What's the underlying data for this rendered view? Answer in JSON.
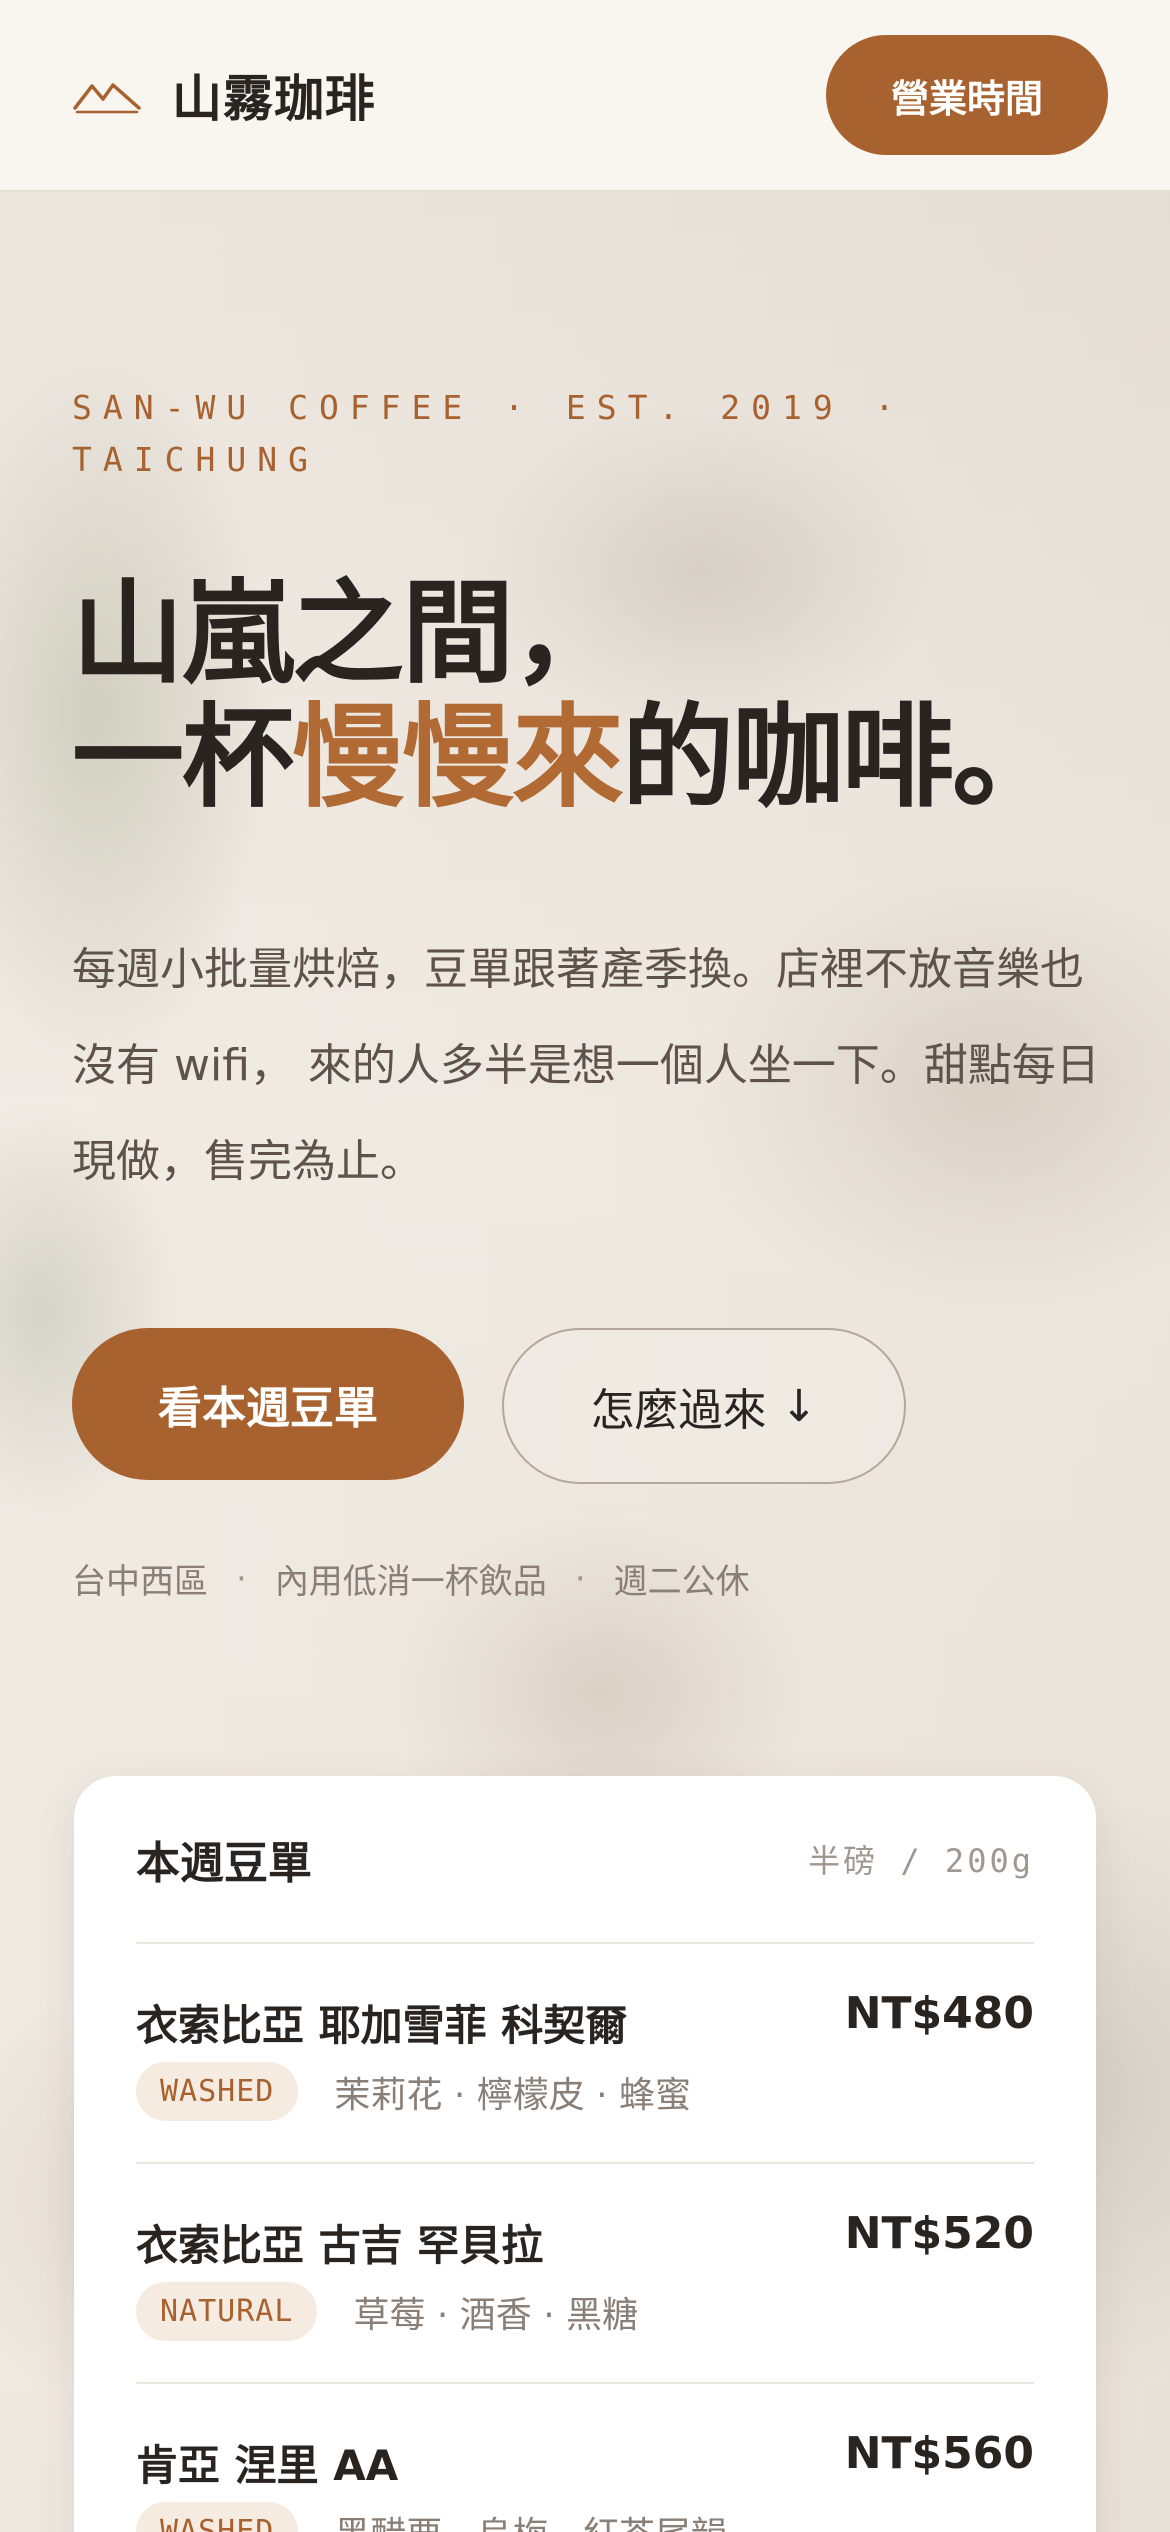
{
  "header": {
    "logo": "mountain-logo",
    "brand_name": "山霧珈琲",
    "hours_button": "營業時間"
  },
  "hero": {
    "eyebrow": "SAN-WU COFFEE · EST. 2019 · TAICHUNG",
    "headline_line1": "山嵐之間，",
    "headline_line2_pre": "一杯",
    "headline_line2_accent": "慢慢來",
    "headline_line2_post": "的咖啡。",
    "lede": "每週小批量烘焙，豆單跟著產季換。店裡不放音樂也沒有 wifi， 來的人多半是想一個人坐一下。甜點每日現做，售完為止。",
    "cta_primary": "看本週豆單",
    "cta_secondary": "怎麼過來",
    "meta": [
      "台中西區",
      "內用低消一杯飲品",
      "週二公休"
    ]
  },
  "beans_card": {
    "title": "本週豆單",
    "unit": "半磅 / 200g",
    "items": [
      {
        "name": "衣索比亞 耶加雪菲 科契爾",
        "price": "NT$480",
        "process": "WASHED",
        "notes": "茉莉花 · 檸檬皮 · 蜂蜜"
      },
      {
        "name": "衣索比亞 古吉 罕貝拉",
        "price": "NT$520",
        "process": "NATURAL",
        "notes": "草莓 · 酒香 · 黑糖"
      },
      {
        "name": "肯亞 涅里 AA",
        "price": "NT$560",
        "process": "WASHED",
        "notes": "黑醋栗 · 烏梅 · 紅茶尾韻"
      }
    ]
  },
  "colors": {
    "accent": "#a8622f",
    "text": "#2a2420",
    "header_bg": "#f9f5ef"
  }
}
